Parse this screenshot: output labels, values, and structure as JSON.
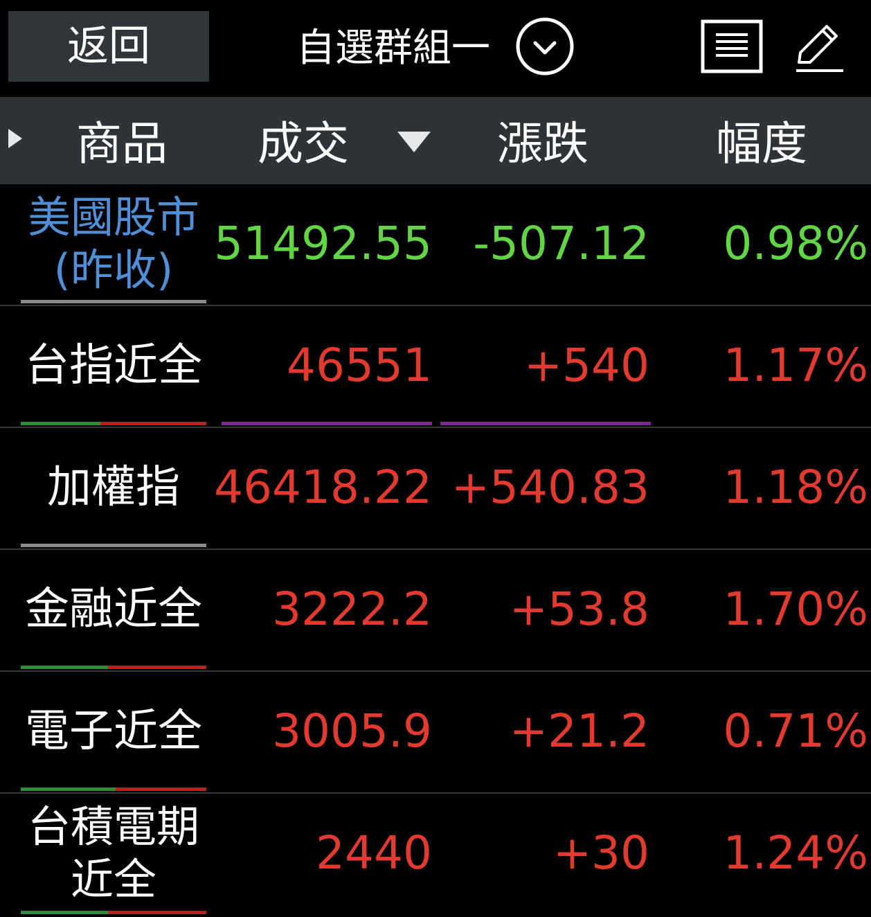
{
  "header": {
    "back_label": "返回",
    "group_title": "自選群組一"
  },
  "columns": {
    "product": "商品",
    "price": "成交",
    "change": "漲跌",
    "percent": "幅度"
  },
  "colors": {
    "background": "#000000",
    "header_bg": "#2e3338",
    "up_red": "#e33a30",
    "down_green": "#62d544",
    "us_market_blue": "#4f8fd8",
    "separator_purple": "#7a2a8c"
  },
  "rows": [
    {
      "name": "美國股市(昨收)",
      "price": "51492.55",
      "change": "-507.12",
      "percent": "0.98%"
    },
    {
      "name": "台指近全",
      "price": "46551",
      "change": "+540",
      "percent": "1.17%"
    },
    {
      "name": "加權指",
      "price": "46418.22",
      "change": "+540.83",
      "percent": "1.18%"
    },
    {
      "name": "金融近全",
      "price": "3222.2",
      "change": "+53.8",
      "percent": "1.70%"
    },
    {
      "name": "電子近全",
      "price": "3005.9",
      "change": "+21.2",
      "percent": "0.71%"
    },
    {
      "name": "台積電期近全",
      "price": "2440",
      "change": "+30",
      "percent": "1.24%"
    }
  ],
  "icons": {
    "dropdown": "chevron-down-circle-icon",
    "list": "list-icon",
    "edit": "pencil-icon",
    "expand": "triangle-right-icon",
    "sort": "sort-desc-icon"
  }
}
